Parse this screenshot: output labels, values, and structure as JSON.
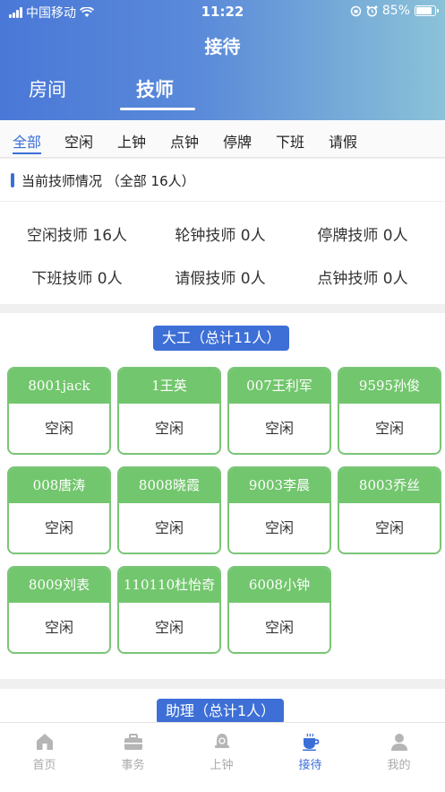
{
  "status_bar": {
    "carrier": "中国移动",
    "time": "11:22",
    "battery": "85%"
  },
  "header": {
    "title": "接待"
  },
  "main_tabs": [
    {
      "label": "房间"
    },
    {
      "label": "技师"
    }
  ],
  "filter_tabs": [
    {
      "label": "全部"
    },
    {
      "label": "空闲"
    },
    {
      "label": "上钟"
    },
    {
      "label": "点钟"
    },
    {
      "label": "停牌"
    },
    {
      "label": "下班"
    },
    {
      "label": "请假"
    }
  ],
  "summary": {
    "title": "当前技师情况 （全部 16人）",
    "stats": [
      "空闲技师 16人",
      "轮钟技师 0人",
      "停牌技师 0人",
      "下班技师 0人",
      "请假技师 0人",
      "点钟技师 0人"
    ]
  },
  "sections": [
    {
      "title": "大工（总计11人）",
      "cards": [
        {
          "name": "8001jack",
          "status": "空闲"
        },
        {
          "name": "1王英",
          "status": "空闲"
        },
        {
          "name": "007王利军",
          "status": "空闲"
        },
        {
          "name": "9595孙俊",
          "status": "空闲"
        },
        {
          "name": "008唐涛",
          "status": "空闲"
        },
        {
          "name": "8008晓霞",
          "status": "空闲"
        },
        {
          "name": "9003李晨",
          "status": "空闲"
        },
        {
          "name": "8003乔丝",
          "status": "空闲"
        },
        {
          "name": "8009刘表",
          "status": "空闲"
        },
        {
          "name": "110110杜怡奇",
          "status": "空闲"
        },
        {
          "name": "6008小钟",
          "status": "空闲"
        }
      ]
    },
    {
      "title": "助理（总计1人）",
      "cards": []
    }
  ],
  "bottom_nav": [
    {
      "label": "首页",
      "icon": "home-icon"
    },
    {
      "label": "事务",
      "icon": "briefcase-icon"
    },
    {
      "label": "上钟",
      "icon": "bell-icon"
    },
    {
      "label": "接待",
      "icon": "coffee-cup-icon"
    },
    {
      "label": "我的",
      "icon": "user-icon"
    }
  ],
  "colors": {
    "accent": "#3b6fd8",
    "card_green": "#72c66d",
    "header_start": "#4a78d8",
    "header_end": "#8bc2d8"
  }
}
